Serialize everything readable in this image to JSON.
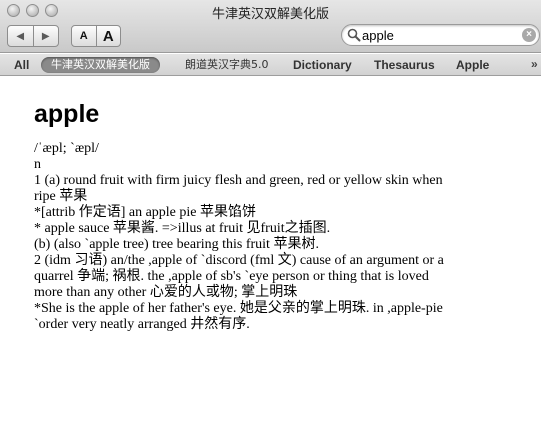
{
  "window": {
    "title": "牛津英汉双解美化版"
  },
  "toolbar": {
    "back_glyph": "◀",
    "forward_glyph": "▶",
    "font_smaller_label": "A",
    "font_larger_label": "A",
    "search_value": "apple",
    "clear_glyph": "×"
  },
  "tabs": [
    {
      "label": "All"
    },
    {
      "label": "牛津英汉双解美化版",
      "active": true
    },
    {
      "label": "朗道英汉字典5.0"
    },
    {
      "label": "Dictionary"
    },
    {
      "label": "Thesaurus"
    },
    {
      "label": "Apple"
    }
  ],
  "tab_overflow": "»",
  "entry": {
    "headword": "apple",
    "lines": [
      "/ˈæpl; `æpl/",
      "n",
      "1 (a) round fruit with firm juicy flesh and green, red or yellow skin when",
      "ripe 苹果",
      "*[attrib 作定语] an apple pie 苹果馅饼",
      "* apple sauce 苹果酱. =>illus at fruit 见fruit之插图.",
      "(b) (also `apple tree) tree bearing this fruit 苹果树.",
      "2 (idm 习语) an/the ,apple of `discord (fml 文) cause of an argument or a",
      "quarrel 争端; 祸根. the ,apple of sb's `eye person or thing that is loved",
      "more than any other 心爱的人或物; 掌上明珠",
      "*She is the apple of her father's eye. 她是父亲的掌上明珠. in ,apple-pie",
      "`order very neatly arranged 井然有序."
    ]
  }
}
